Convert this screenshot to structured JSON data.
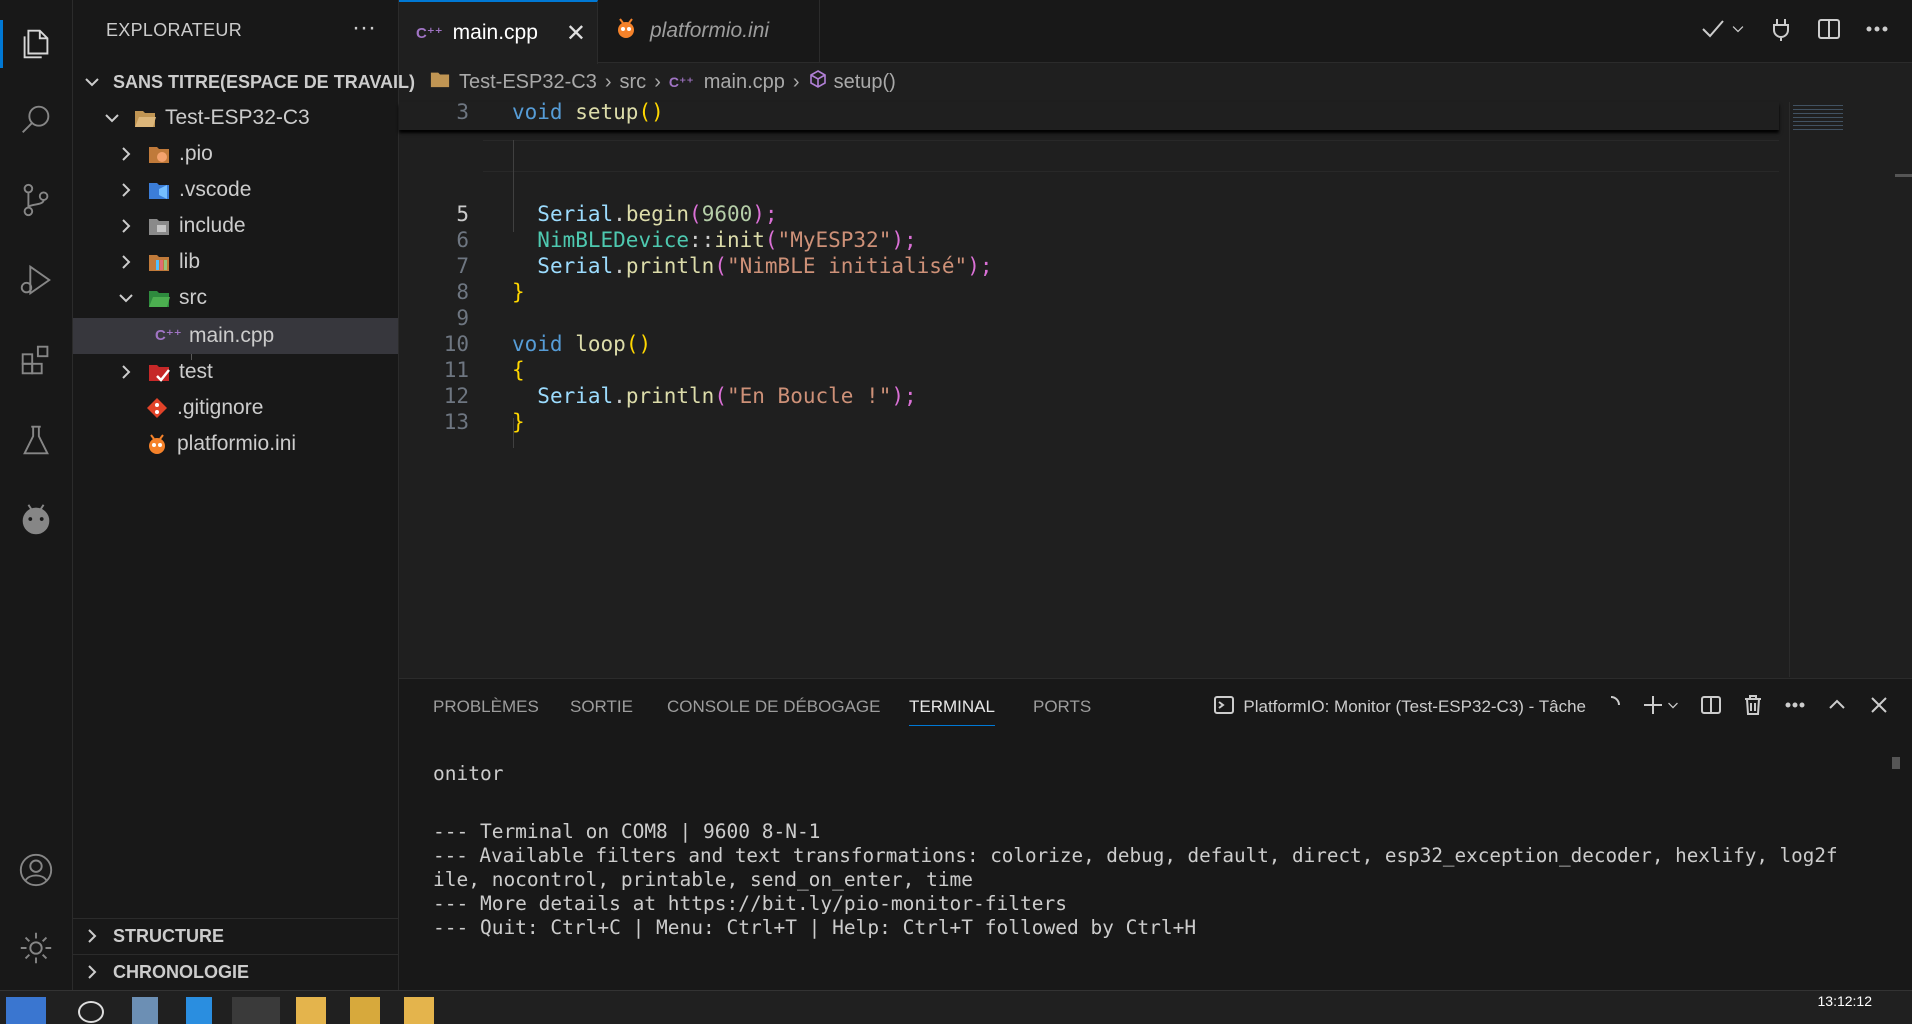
{
  "sidebar": {
    "title": "EXPLORATEUR",
    "more": "···",
    "workspace": "SANS TITRE(ESPACE DE TRAVAIL)",
    "tree": [
      {
        "label": "Test-ESP32-C3"
      },
      {
        "label": ".pio"
      },
      {
        "label": ".vscode"
      },
      {
        "label": "include"
      },
      {
        "label": "lib"
      },
      {
        "label": "src"
      },
      {
        "label": "main.cpp"
      },
      {
        "label": "test"
      },
      {
        "label": ".gitignore"
      },
      {
        "label": "platformio.ini"
      }
    ],
    "sections": [
      "STRUCTURE",
      "CHRONOLOGIE"
    ]
  },
  "tabs": [
    {
      "label": "main.cpp",
      "icon": "C++",
      "close": "✕"
    },
    {
      "label": "platformio.ini"
    }
  ],
  "breadcrumb": [
    "Test-ESP32-C3",
    "src",
    "main.cpp",
    "setup()"
  ],
  "code": {
    "line_numbers": [
      "3",
      "5",
      "6",
      "7",
      "8",
      "9",
      "10",
      "11",
      "12",
      "13"
    ],
    "lines": {
      "l3": {
        "kw": "void",
        "fn": "setup",
        "br": "()"
      },
      "l5": {
        "obj": "Serial",
        "dot": ".",
        "fn": "begin",
        "op": "(",
        "num": "9600",
        "cl": ");"
      },
      "l6": {
        "ty": "NimBLEDevice",
        "sep": "::",
        "fn": "init",
        "op": "(",
        "str": "\"MyESP32\"",
        "cl": ");"
      },
      "l7": {
        "obj": "Serial",
        "dot": ".",
        "fn": "println",
        "op": "(",
        "str": "\"NimBLE initialisé\"",
        "cl": ");"
      },
      "l8": {
        "br": "}"
      },
      "l10": {
        "kw": "void",
        "fn": "loop",
        "br": "()"
      },
      "l11": {
        "br": "{"
      },
      "l12": {
        "obj": "Serial",
        "dot": ".",
        "fn": "println",
        "op": "(",
        "str": "\"En Boucle !\"",
        "cl": ");"
      },
      "l13": {
        "br": "}"
      }
    }
  },
  "panel": {
    "tabs": [
      "PROBLÈMES",
      "SORTIE",
      "CONSOLE DE DÉBOGAGE",
      "TERMINAL",
      "PORTS"
    ],
    "active_tab": "TERMINAL",
    "terminal_name": "PlatformIO: Monitor (Test-ESP32-C3) - Tâche",
    "terminal_lines": [
      "onitor",
      "",
      "--- Terminal on COM8 | 9600 8-N-1",
      "--- Available filters and text transformations: colorize, debug, default, direct, esp32_exception_decoder, hexlify, log2f",
      "ile, nocontrol, printable, send_on_enter, time",
      "--- More details at https://bit.ly/pio-monitor-filters",
      "--- Quit: Ctrl+C | Menu: Ctrl+T | Help: Ctrl+T followed by Ctrl+H"
    ]
  },
  "taskbar": {
    "clock": "13:12:12"
  },
  "colors": {
    "accent": "#0078d4",
    "keyword": "#569cd6",
    "function": "#dcdcaa",
    "type": "#4ec9b0",
    "string": "#ce9178",
    "number": "#b5cea8"
  }
}
